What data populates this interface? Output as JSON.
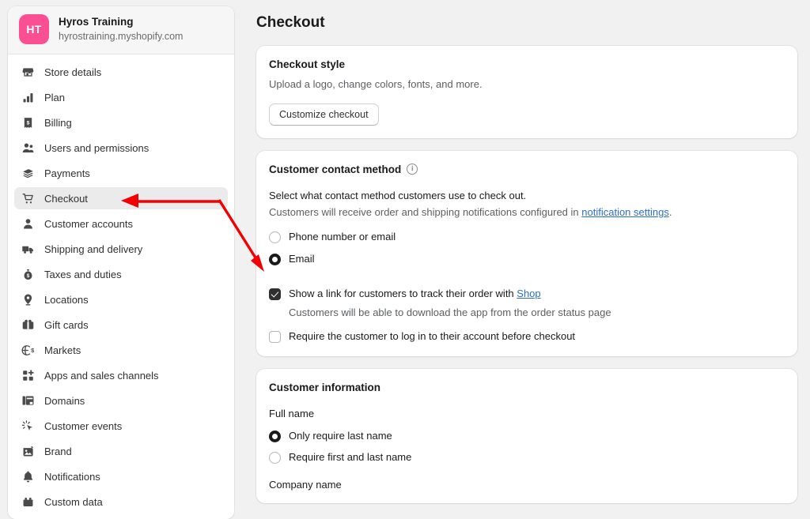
{
  "store": {
    "avatar_initials": "HT",
    "name": "Hyros Training",
    "domain": "hyrostraining.myshopify.com",
    "avatar_color": "#fb4f93"
  },
  "sidebar": {
    "items": [
      {
        "label": "Store details",
        "icon": "store-icon",
        "active": false
      },
      {
        "label": "Plan",
        "icon": "plan-icon",
        "active": false
      },
      {
        "label": "Billing",
        "icon": "billing-icon",
        "active": false
      },
      {
        "label": "Users and permissions",
        "icon": "users-icon",
        "active": false
      },
      {
        "label": "Payments",
        "icon": "payments-icon",
        "active": false
      },
      {
        "label": "Checkout",
        "icon": "cart-icon",
        "active": true
      },
      {
        "label": "Customer accounts",
        "icon": "person-icon",
        "active": false
      },
      {
        "label": "Shipping and delivery",
        "icon": "truck-icon",
        "active": false
      },
      {
        "label": "Taxes and duties",
        "icon": "taxes-icon",
        "active": false
      },
      {
        "label": "Locations",
        "icon": "location-pin-icon",
        "active": false
      },
      {
        "label": "Gift cards",
        "icon": "gift-card-icon",
        "active": false
      },
      {
        "label": "Markets",
        "icon": "globe-icon",
        "active": false
      },
      {
        "label": "Apps and sales channels",
        "icon": "apps-grid-icon",
        "active": false
      },
      {
        "label": "Domains",
        "icon": "domains-icon",
        "active": false
      },
      {
        "label": "Customer events",
        "icon": "customer-events-icon",
        "active": false
      },
      {
        "label": "Brand",
        "icon": "brand-image-icon",
        "active": false
      },
      {
        "label": "Notifications",
        "icon": "bell-icon",
        "active": false
      },
      {
        "label": "Custom data",
        "icon": "custom-data-icon",
        "active": false
      }
    ]
  },
  "main": {
    "page_title": "Checkout",
    "checkout_style": {
      "title": "Checkout style",
      "description": "Upload a logo, change colors, fonts, and more.",
      "button_label": "Customize checkout"
    },
    "contact_method": {
      "title": "Customer contact method",
      "info_glyph": "i",
      "lead": "Select what contact method customers use to check out.",
      "lead_prefix": "Customers will receive order and shipping notifications configured in ",
      "lead_link": "notification settings",
      "lead_suffix": ".",
      "options": [
        {
          "label": "Phone number or email",
          "checked": false
        },
        {
          "label": "Email",
          "checked": true
        }
      ],
      "checkboxes": [
        {
          "label_prefix": "Show a link for customers to track their order with ",
          "label_link": "Shop",
          "help": "Customers will be able to download the app from the order status page",
          "checked": true
        },
        {
          "label_prefix": "Require the customer to log in to their account before checkout",
          "label_link": "",
          "help": "",
          "checked": false
        }
      ]
    },
    "customer_information": {
      "title": "Customer information",
      "full_name_label": "Full name",
      "full_name_options": [
        {
          "label": "Only require last name",
          "checked": true
        },
        {
          "label": "Require first and last name",
          "checked": false
        }
      ],
      "company_name_label": "Company name"
    }
  },
  "annotations": {
    "color": "#f40000",
    "arrow_1_target": "sidebar-item-checkout",
    "arrow_2_target": "radio-email"
  }
}
